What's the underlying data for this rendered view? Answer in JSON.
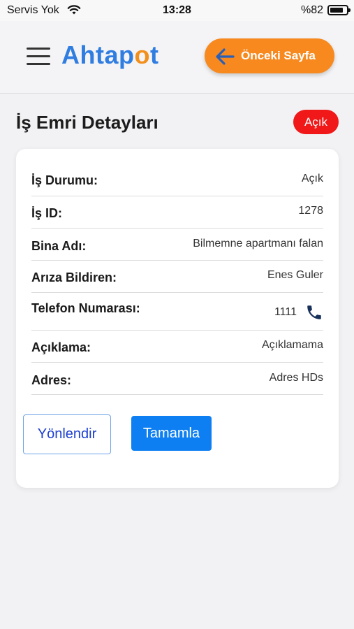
{
  "status_bar": {
    "carrier": "Servis Yok",
    "time": "13:28",
    "battery": "%82",
    "battery_level": 0.82
  },
  "header": {
    "logo_prefix": "Ahtap",
    "logo_o": "o",
    "logo_suffix": "t",
    "back_label": "Önceki Sayfa"
  },
  "page": {
    "title": "İş Emri Detayları",
    "status_badge": "Açık"
  },
  "details": {
    "status": {
      "label": "İş Durumu:",
      "value": "Açık"
    },
    "id": {
      "label": "İş ID:",
      "value": "1278"
    },
    "building": {
      "label": "Bina Adı:",
      "value": "Bilmemne apartmanı falan"
    },
    "reporter": {
      "label": "Arıza Bildiren:",
      "value": "Enes Guler"
    },
    "phone": {
      "label": "Telefon Numarası:",
      "value": "1111"
    },
    "description": {
      "label": "Açıklama:",
      "value": "Açıklamama"
    },
    "address": {
      "label": "Adres:",
      "value": "Adres HDs"
    }
  },
  "actions": {
    "redirect_label": "Yönlendir",
    "complete_label": "Tamamla"
  },
  "colors": {
    "brand_blue": "#2f7de0",
    "brand_orange": "#f7891f",
    "badge_red": "#f01818",
    "primary_button": "#0d7ff2"
  }
}
